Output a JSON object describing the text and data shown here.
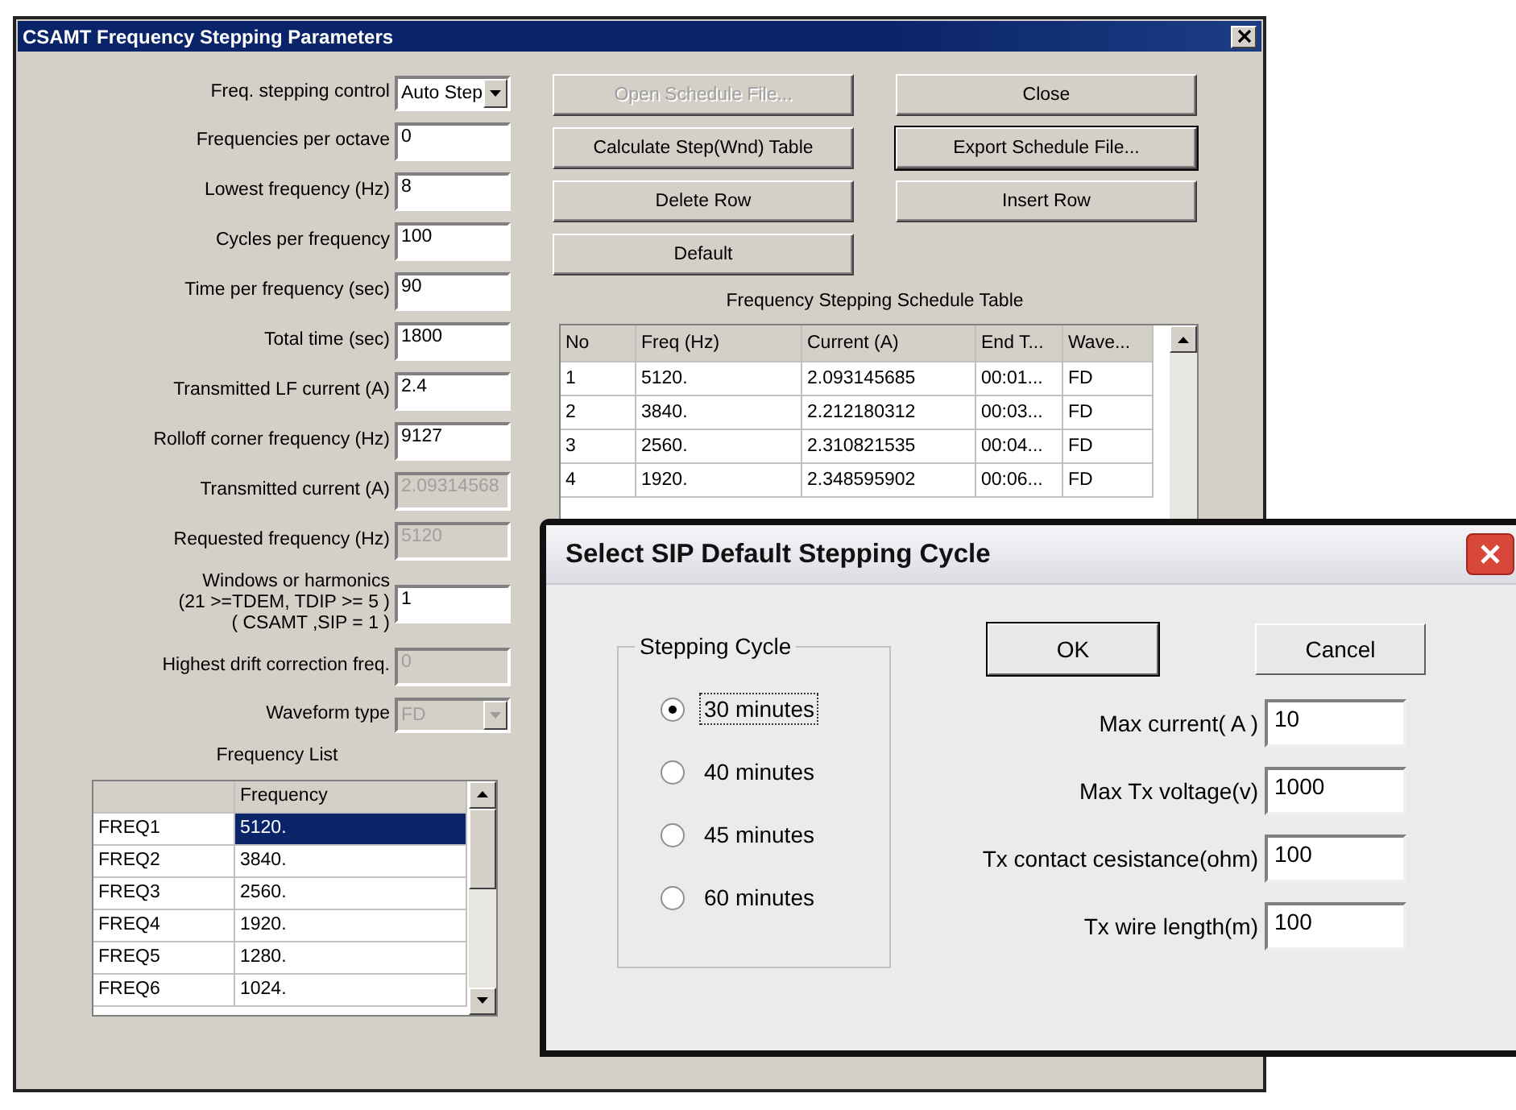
{
  "window": {
    "title": "CSAMT Frequency Stepping Parameters"
  },
  "fields": [
    {
      "label": "Freq. stepping control",
      "value": "Auto Step",
      "kind": "dropdown",
      "disabled": false
    },
    {
      "label": "Frequencies per octave",
      "value": "0",
      "kind": "input",
      "disabled": false
    },
    {
      "label": "Lowest frequency (Hz)",
      "value": "8",
      "kind": "input",
      "disabled": false
    },
    {
      "label": "Cycles per frequency",
      "value": "100",
      "kind": "input",
      "disabled": false
    },
    {
      "label": "Time per frequency (sec)",
      "value": "90",
      "kind": "input",
      "disabled": false
    },
    {
      "label": "Total time (sec)",
      "value": "1800",
      "kind": "input",
      "disabled": false
    },
    {
      "label": "Transmitted LF current (A)",
      "value": "2.4",
      "kind": "input",
      "disabled": false
    },
    {
      "label": "Rolloff corner frequency (Hz)",
      "value": "9127",
      "kind": "input",
      "disabled": false
    },
    {
      "label": "Transmitted current (A)",
      "value": "2.09314568",
      "kind": "input",
      "disabled": true
    },
    {
      "label": "Requested  frequency (Hz)",
      "value": "5120",
      "kind": "input",
      "disabled": true
    },
    {
      "label": "Windows or harmonics\n(21 >=TDEM, TDIP >= 5 )\n( CSAMT ,SIP = 1 )",
      "value": "1",
      "kind": "input",
      "disabled": false
    },
    {
      "label": "Highest drift correction freq.",
      "value": "0",
      "kind": "input",
      "disabled": true
    },
    {
      "label": "Waveform type",
      "value": "FD",
      "kind": "dropdown",
      "disabled": true
    }
  ],
  "frequency_list": {
    "title": "Frequency List",
    "columns": [
      "",
      "Frequency"
    ],
    "rows": [
      {
        "name": "FREQ1",
        "value": "5120.",
        "selected": true
      },
      {
        "name": "FREQ2",
        "value": "3840.",
        "selected": false
      },
      {
        "name": "FREQ3",
        "value": "2560.",
        "selected": false
      },
      {
        "name": "FREQ4",
        "value": "1920.",
        "selected": false
      },
      {
        "name": "FREQ5",
        "value": "1280.",
        "selected": false
      },
      {
        "name": "FREQ6",
        "value": "1024.",
        "selected": false
      }
    ]
  },
  "buttons": [
    {
      "label": "Open Schedule File...",
      "disabled": true,
      "focused": false
    },
    {
      "label": "Close",
      "disabled": false,
      "focused": false
    },
    {
      "label": "Calculate Step(Wnd) Table",
      "disabled": false,
      "focused": false
    },
    {
      "label": "Export Schedule File...",
      "disabled": false,
      "focused": true
    },
    {
      "label": "Delete Row",
      "disabled": false,
      "focused": false
    },
    {
      "label": "Insert Row",
      "disabled": false,
      "focused": false
    },
    {
      "label": "Default",
      "disabled": false,
      "focused": false
    }
  ],
  "schedule_table": {
    "title": "Frequency Stepping Schedule Table",
    "columns": [
      "No",
      "Freq (Hz)",
      "Current (A)",
      "End T...",
      "Wave..."
    ],
    "rows": [
      [
        "1",
        "5120.",
        "2.093145685",
        "00:01...",
        "FD"
      ],
      [
        "2",
        "3840.",
        "2.212180312",
        "00:03...",
        "FD"
      ],
      [
        "3",
        "2560.",
        "2.310821535",
        "00:04...",
        "FD"
      ],
      [
        "4",
        "1920.",
        "2.348595902",
        "00:06...",
        "FD"
      ]
    ]
  },
  "dialog": {
    "title": "Select SIP Default Stepping Cycle",
    "group_label": "Stepping Cycle",
    "options": [
      {
        "label": "30 minutes",
        "selected": true
      },
      {
        "label": "40 minutes",
        "selected": false
      },
      {
        "label": "45 minutes",
        "selected": false
      },
      {
        "label": "60 minutes",
        "selected": false
      }
    ],
    "buttons": [
      {
        "label": "OK",
        "default": true
      },
      {
        "label": "Cancel",
        "default": false
      }
    ],
    "fields": [
      {
        "label": "Max current( A )",
        "value": "10"
      },
      {
        "label": "Max Tx voltage(v)",
        "value": "1000"
      },
      {
        "label": "Tx contact cesistance(ohm)",
        "value": "100"
      },
      {
        "label": "Tx wire length(m)",
        "value": "100"
      }
    ]
  }
}
